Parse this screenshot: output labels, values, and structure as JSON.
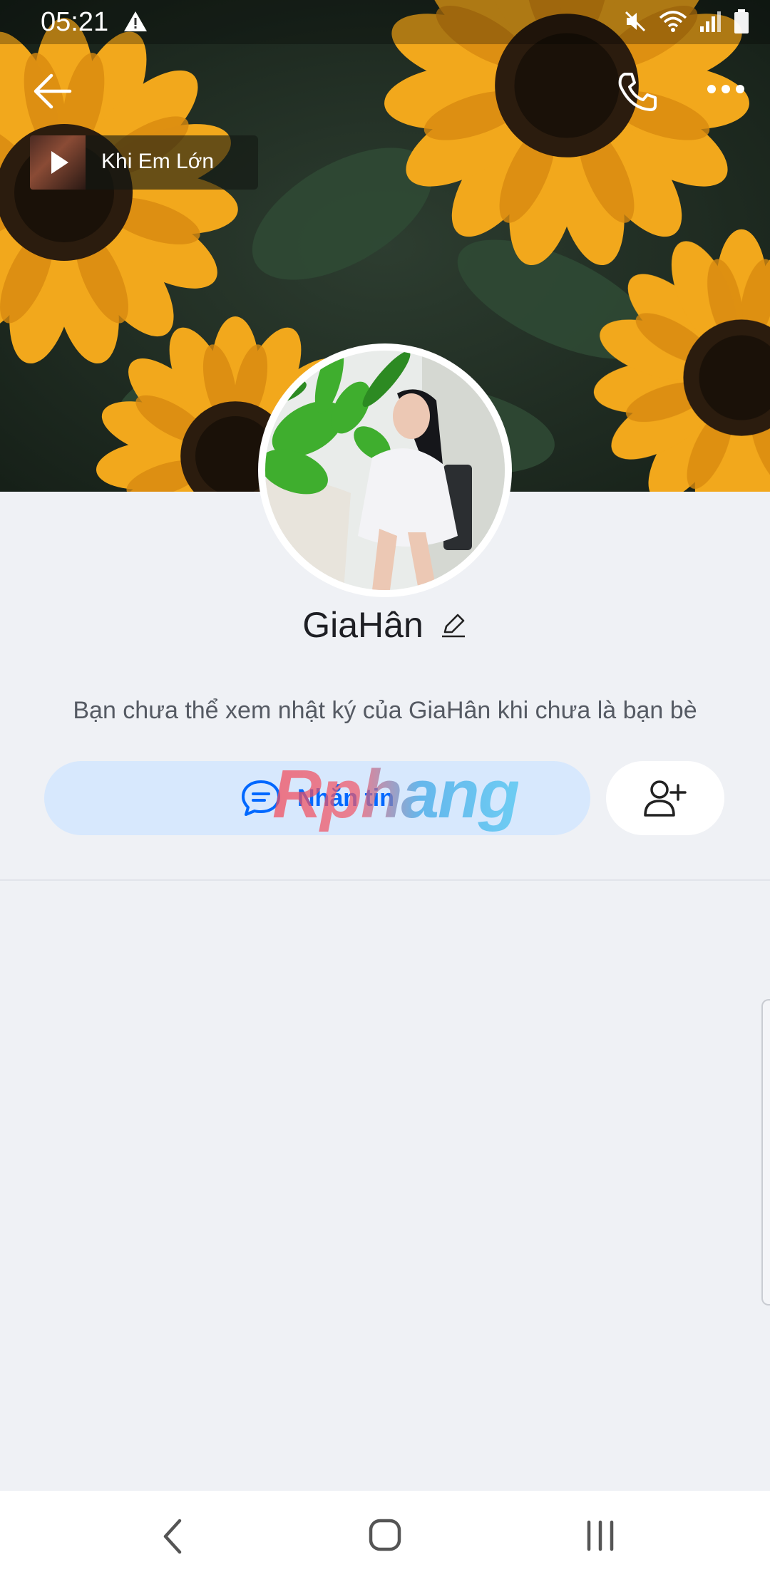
{
  "status_bar": {
    "time": "05:21",
    "icons": [
      "warning-icon",
      "mute-icon",
      "wifi-icon",
      "signal-icon",
      "battery-icon"
    ]
  },
  "header": {
    "icons": [
      "back-arrow-icon",
      "phone-icon",
      "more-dots-icon"
    ]
  },
  "music": {
    "title": "Khi Em Lớn",
    "icon": "play-icon"
  },
  "profile": {
    "name": "GiaHân",
    "edit_icon": "pencil-icon",
    "notice": "Bạn chưa thể xem nhật ký của GiaHân khi chưa là bạn bè"
  },
  "actions": {
    "message_label": "Nhắn tin",
    "message_icon": "chat-icon",
    "add_friend_icon": "add-user-icon"
  },
  "watermark": {
    "text": "Rphang"
  },
  "nav": {
    "icons": [
      "nav-back-icon",
      "nav-home-icon",
      "nav-recents-icon"
    ]
  },
  "colors": {
    "accent": "#0068ff",
    "message_button_bg": "#d7e8fd",
    "page_bg": "#eff1f5"
  }
}
